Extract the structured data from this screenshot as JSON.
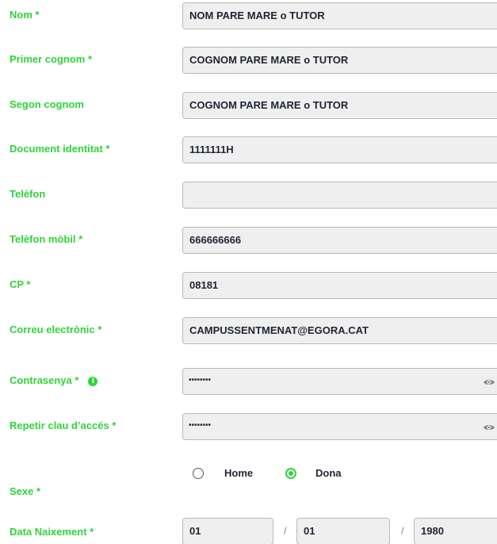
{
  "form": {
    "fields": [
      {
        "label": "Nom *",
        "value": "NOM PARE MARE o TUTOR"
      },
      {
        "label": "Primer cognom *",
        "value": "COGNOM PARE MARE o TUTOR"
      },
      {
        "label": "Segon cognom",
        "value": "COGNOM PARE MARE o TUTOR"
      },
      {
        "label": "Document identitat *",
        "value": "1111111H"
      },
      {
        "label": "Telèfon",
        "value": ""
      },
      {
        "label": "Telèfon mòbil *",
        "value": "666666666"
      },
      {
        "label": "CP *",
        "value": "08181"
      },
      {
        "label": "Correu electrònic *",
        "value": "CAMPUSSENTMENAT@EGORA.CAT"
      }
    ],
    "password": {
      "label": "Contrasenya *",
      "value": "••••••••",
      "info_icon": "info-icon"
    },
    "repeat_password": {
      "label": "Repetir clau d’accés *",
      "value": "••••••••"
    },
    "sex": {
      "label": "Sexe *",
      "options": [
        "Home",
        "Dona"
      ],
      "selected": "Dona"
    },
    "birth_date": {
      "label": "Data Naixement *",
      "day": "01",
      "month": "01",
      "year": "1980"
    }
  },
  "colors": {
    "label_green": "#2fd43a",
    "field_bg": "#efefef",
    "field_border": "#b8b8b8",
    "text_dark": "#1f2433"
  }
}
